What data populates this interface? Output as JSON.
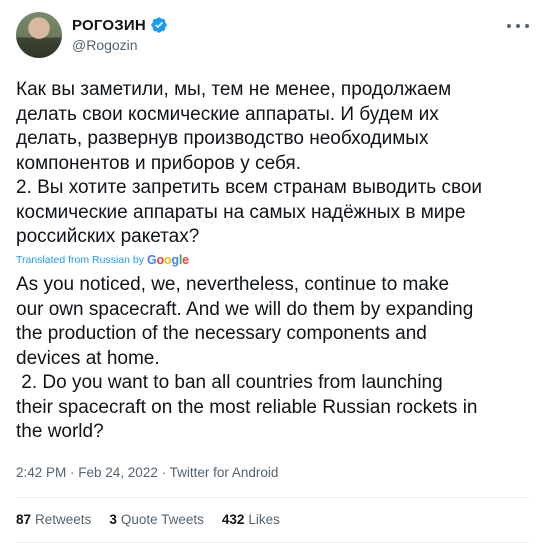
{
  "author": {
    "display_name": "РОГОЗИН",
    "handle": "@Rogozin"
  },
  "tweet": {
    "original_text": "Как вы заметили, мы, тем не менее, продолжаем\nделать свои космические аппараты. И будем их\nделать, развернув производство необходимых\nкомпонентов и приборов у себя.\n2. Вы хотите запретить всем странам выводить свои\nкосмические аппараты на самых надёжных в мире\nроссийских ракетах?",
    "translated_label": "Translated from Russian by",
    "translator_brand": "Google",
    "translated_text": "As you noticed, we, nevertheless, continue to make\nour own spacecraft. And we will do them by expanding\nthe production of the necessary components and\ndevices at home.\n 2. Do you want to ban all countries from launching\ntheir spacecraft on the most reliable Russian rockets in\nthe world?",
    "timestamp": "2:42 PM · Feb 24, 2022 · Twitter for Android"
  },
  "stats": {
    "retweets_count": "87",
    "retweets_label": "Retweets",
    "quotes_count": "3",
    "quotes_label": "Quote Tweets",
    "likes_count": "432",
    "likes_label": "Likes"
  },
  "colors": {
    "accent": "#1d9bf0",
    "secondary_text": "#536471",
    "text": "#0f1419"
  },
  "icons": [
    "verified-badge-icon",
    "more-options-icon"
  ]
}
